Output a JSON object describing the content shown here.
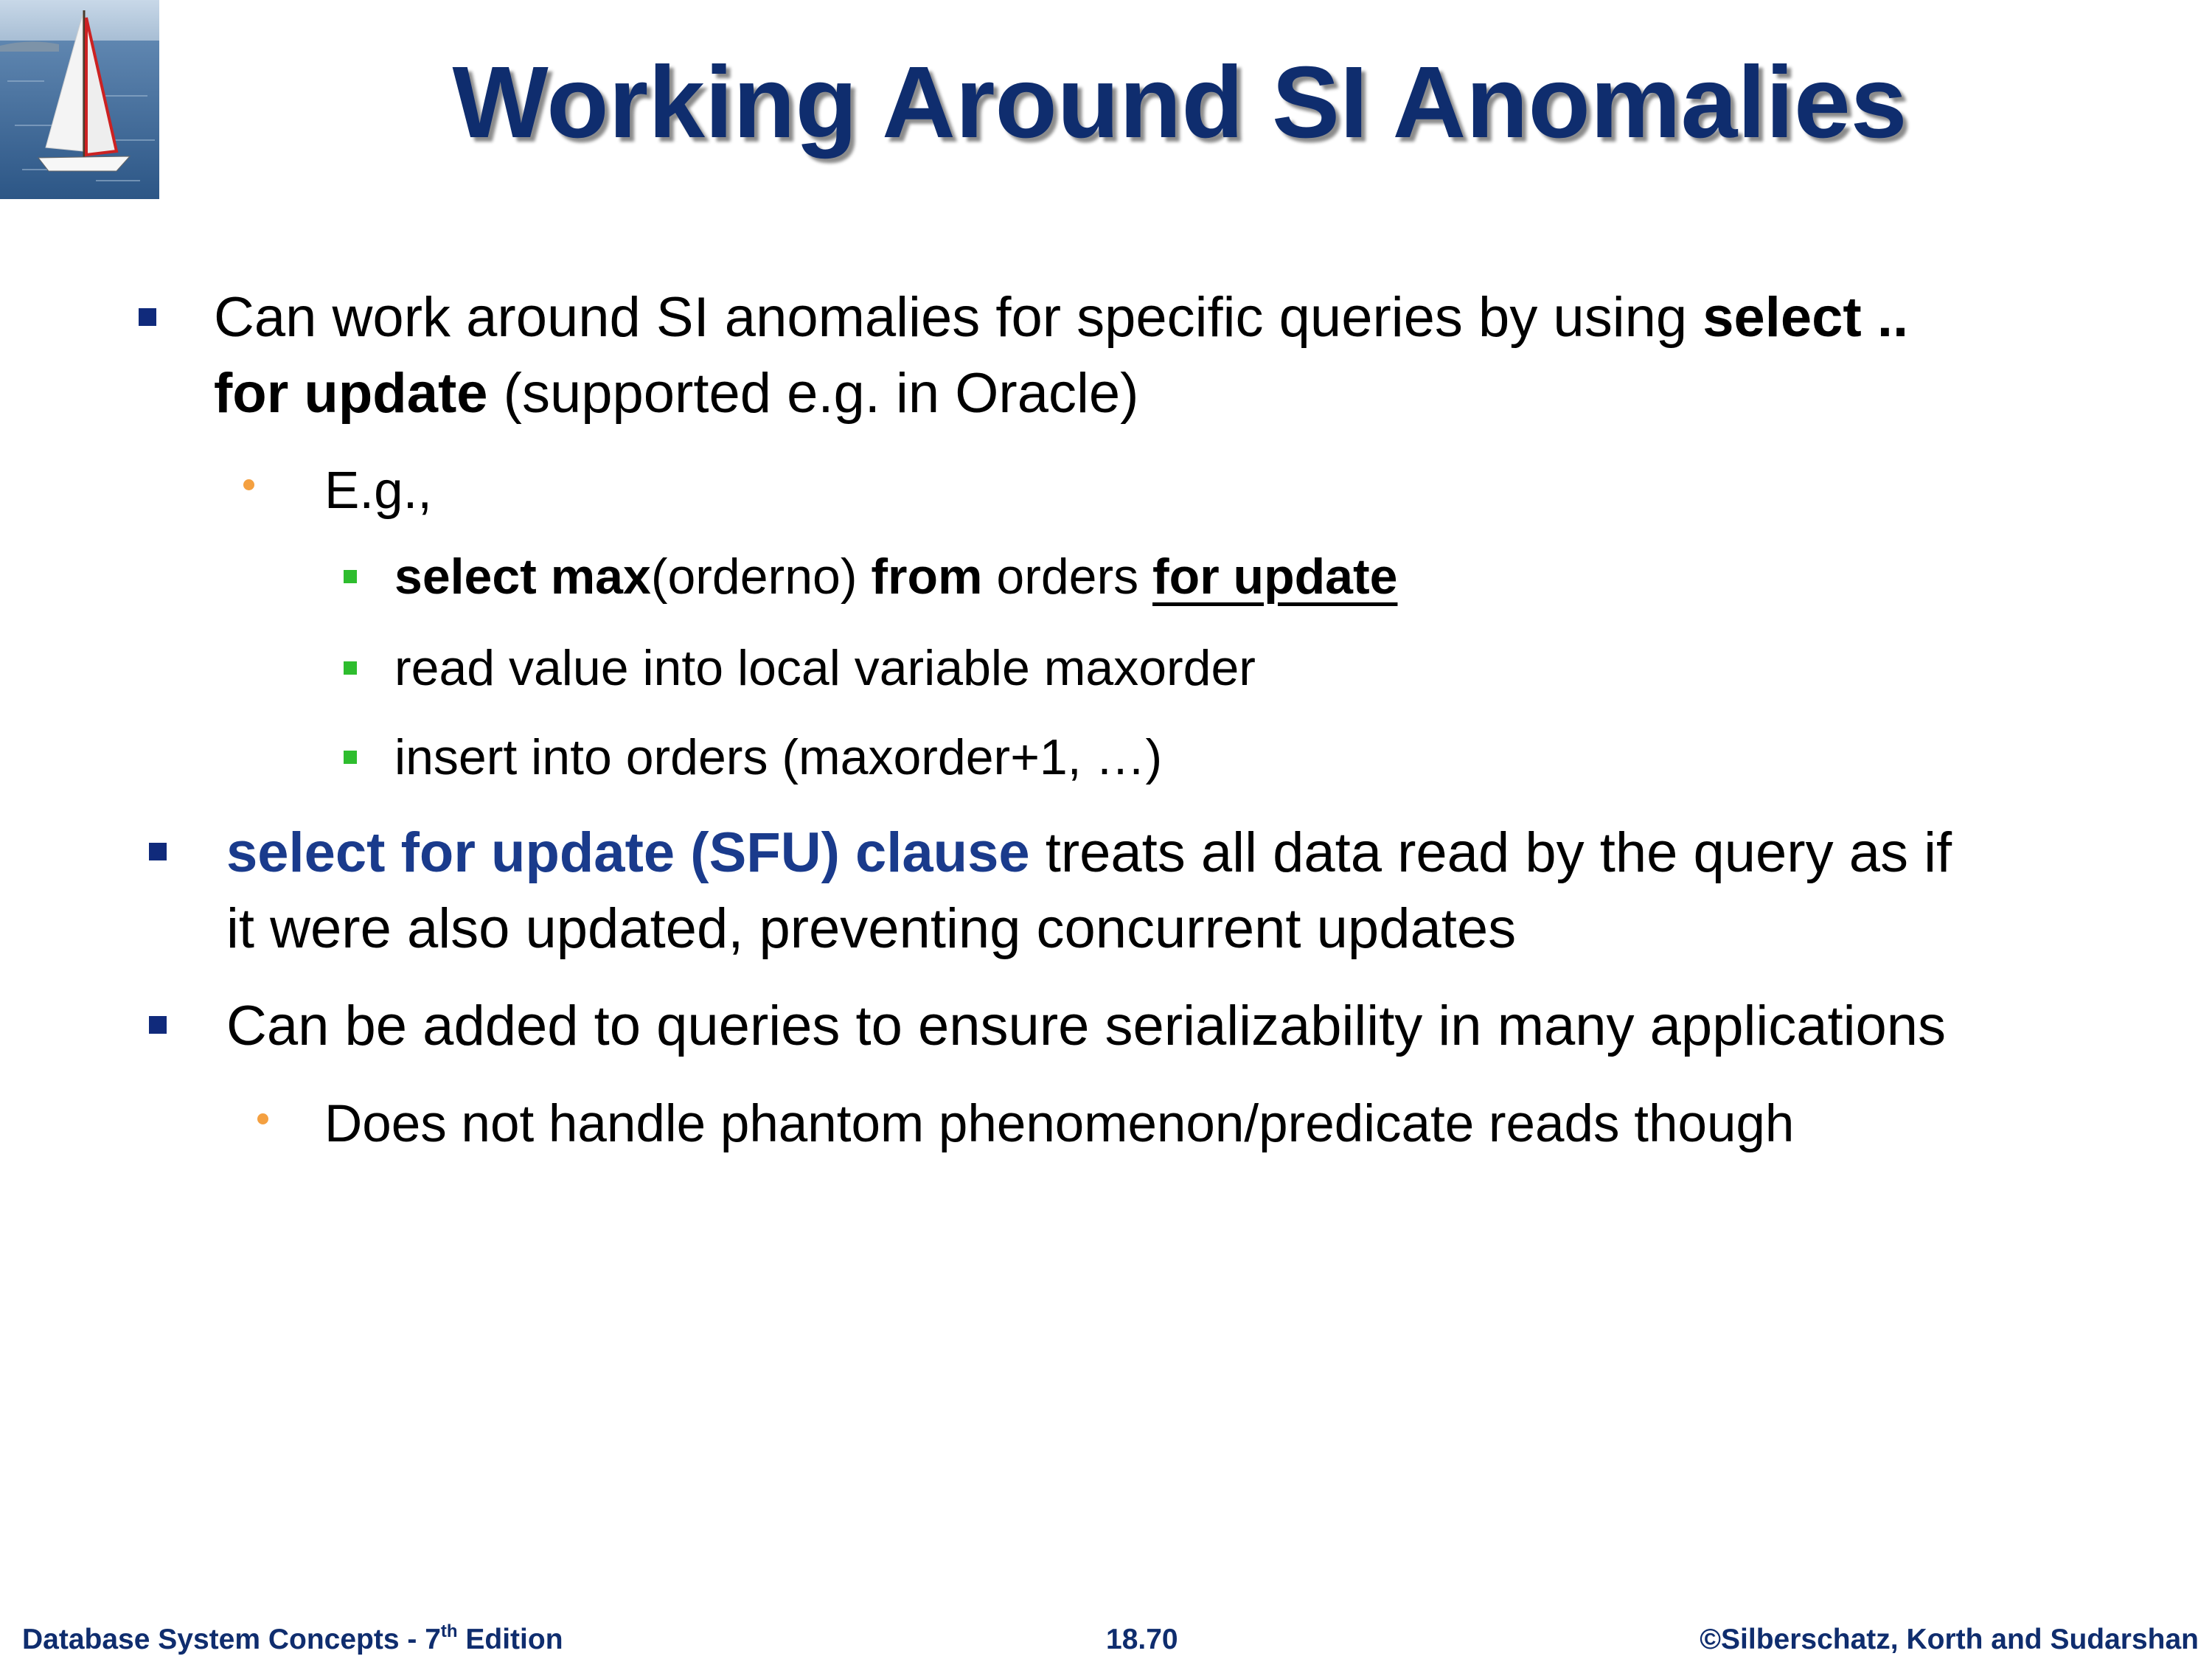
{
  "title": "Working Around SI Anomalies",
  "bullet1": {
    "text_a": "Can work around SI anomalies for specific queries by using ",
    "bold_a": "select ..",
    "bold_b": "for update",
    "text_b": "  (supported e.g. in Oracle)"
  },
  "bullet1_sub": {
    "text": "E.g.,"
  },
  "bullet1_items": [
    {
      "b1": "select max",
      "t1": "(orderno) ",
      "b2": "from",
      "t2": " orders ",
      "bu": "for update"
    },
    {
      "text": "read value into local variable maxorder"
    },
    {
      "text": "insert into orders (maxorder+1, …)"
    }
  ],
  "bullet2": {
    "highlight": "select for update (SFU) clause",
    "text_a": " treats all data read by the query as if",
    "text_b": "it were also updated, preventing concurrent updates"
  },
  "bullet3": {
    "text": "Can be added to queries to ensure serializability in many applications"
  },
  "bullet3_sub": {
    "text": "Does not handle phantom phenomenon/predicate reads though"
  },
  "footer": {
    "left_a": "Database System Concepts - 7",
    "left_sup": "th",
    "left_b": " Edition",
    "center": "18.70",
    "right": "©Silberschatz, Korth and Sudarshan"
  },
  "logo": {
    "icon": "sailboat-icon"
  },
  "colors": {
    "title": "#0f2d6e",
    "highlight": "#1a3b8c",
    "bullet_blue": "#102a7b",
    "bullet_green": "#2ebd2e",
    "bullet_orange": "#f4a040"
  }
}
